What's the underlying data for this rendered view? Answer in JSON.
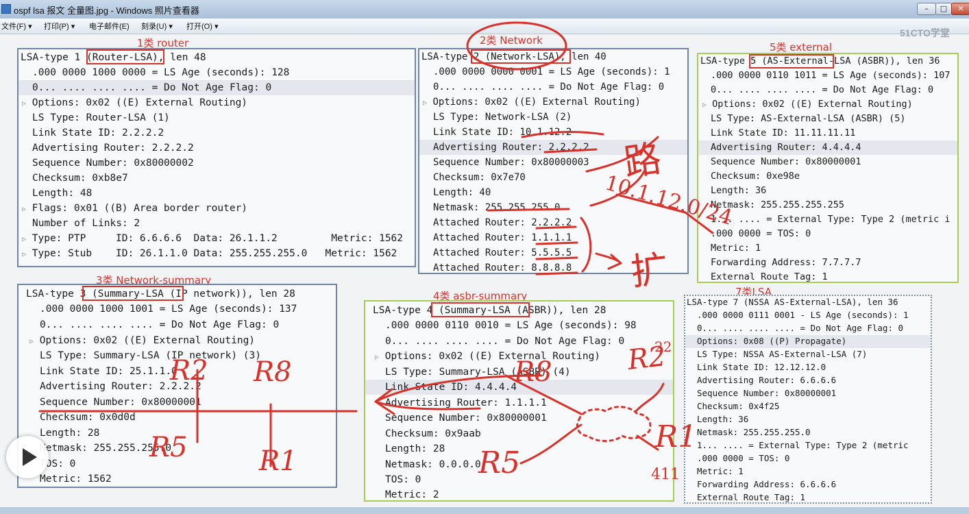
{
  "window": {
    "title": "ospf lsa 报文 全量图.jpg - Windows 照片查看器",
    "brand": "51CTO学堂"
  },
  "menu": [
    "文件(F) ▾",
    "打印(P) ▾",
    "电子邮件(E)",
    "刻录(U) ▾",
    "打开(O) ▾"
  ],
  "captions": {
    "router": "1类 router",
    "network": "2类 Network",
    "external": "5类 external",
    "summary": "3类  Network-summary",
    "asbr": "4类 asbr-summary",
    "nssa": "7类LSA"
  },
  "panels": {
    "router": [
      "LSA-type 1 (Router-LSA), len 48",
      ".000 0000 1000 0000 = LS Age (seconds): 128",
      "0... .... .... .... = Do Not Age Flag: 0",
      "Options: 0x02 ((E) External Routing)",
      "LS Type: Router-LSA (1)",
      "Link State ID: 2.2.2.2",
      "Advertising Router: 2.2.2.2",
      "Sequence Number: 0x80000002",
      "Checksum: 0xb8e7",
      "Length: 48",
      "Flags: 0x01 ((B) Area border router)",
      "Number of Links: 2",
      "Type: PTP     ID: 6.6.6.6  Data: 26.1.1.2         Metric: 1562",
      "Type: Stub    ID: 26.1.1.0 Data: 255.255.255.0   Metric: 1562"
    ],
    "network": [
      "LSA-type 2 (Network-LSA), len 40",
      ".000 0000 0000 0001 = LS Age (seconds): 1",
      "0... .... .... .... = Do Not Age Flag: 0",
      "Options: 0x02 ((E) External Routing)",
      "LS Type: Network-LSA (2)",
      "Link State ID: 10.1.12.2",
      "Advertising Router: 2.2.2.2",
      "Sequence Number: 0x80000003",
      "Checksum: 0x7e70",
      "Length: 40",
      "Netmask: 255.255.255.0",
      "Attached Router: 2.2.2.2",
      "Attached Router: 1.1.1.1",
      "Attached Router: 5.5.5.5",
      "Attached Router: 8.8.8.8"
    ],
    "external": [
      "LSA-type 5 (AS-External-LSA (ASBR)), len 36",
      ".000 0000 0110 1011 = LS Age (seconds): 107",
      "0... .... .... .... = Do Not Age Flag: 0",
      "Options: 0x02 ((E) External Routing)",
      "LS Type: AS-External-LSA (ASBR) (5)",
      "Link State ID: 11.11.11.11",
      "Advertising Router: 4.4.4.4",
      "Sequence Number: 0x80000001",
      "Checksum: 0xe98e",
      "Length: 36",
      "Netmask: 255.255.255.255",
      "1... .... = External Type: Type 2 (metric i",
      ".000 0000 = TOS: 0",
      "Metric: 1",
      "Forwarding Address: 7.7.7.7",
      "External Route Tag: 1"
    ],
    "summary": [
      "LSA-type 3 (Summary-LSA (IP network)), len 28",
      ".000 0000 1000 1001 = LS Age (seconds): 137",
      "0... .... .... .... = Do Not Age Flag: 0",
      "Options: 0x02 ((E) External Routing)",
      "LS Type: Summary-LSA (IP network) (3)",
      "Link State ID: 25.1.1.0",
      "Advertising Router: 2.2.2.2",
      "Sequence Number: 0x80000001",
      "Checksum: 0x0d0d",
      "Length: 28",
      "Netmask: 255.255.255.0",
      "TOS: 0",
      "Metric: 1562"
    ],
    "asbr": [
      "LSA-type 4 (Summary-LSA (ASBR)), len 28",
      ".000 0000 0110 0010 = LS Age (seconds): 98",
      "0... .... .... .... = Do Not Age Flag: 0",
      "Options: 0x02 ((E) External Routing)",
      "LS Type: Summary-LSA (ASBR) (4)",
      "Link State ID: 4.4.4.4",
      "Advertising Router: 1.1.1.1",
      "Sequence Number: 0x80000001",
      "Checksum: 0x9aab",
      "Length: 28",
      "Netmask: 0.0.0.0",
      "TOS: 0",
      "Metric: 2"
    ],
    "nssa": [
      "LSA-type 7 (NSSA AS-External-LSA), len 36",
      ".000 0000 0111 0001 - LS Age (seconds): 1",
      "0... .... .... .... = Do Not Age Flag: 0",
      "Options: 0x08 ((P) Propagate)",
      "LS Type: NSSA AS-External-LSA (7)",
      "Link State ID: 12.12.12.0",
      "Advertising Router: 6.6.6.6",
      "Sequence Number: 0x80000001",
      "Checksum: 0x4f25",
      "Length: 36",
      "Netmask: 255.255.255.0",
      "1... .... = External Type: Type 2 (metric",
      ".000 0000 = TOS: 0",
      "Metric: 1",
      "Forwarding Address: 6.6.6.6",
      "External Route Tag: 1"
    ]
  },
  "annotations": {
    "route": "路",
    "subnet": "10.1.12.0/24",
    "extend": "扩",
    "r2_summary": "R2",
    "r8": "R8",
    "r5_summary": "R5",
    "r1_summary": "R1",
    "r8_asbr": "R8",
    "r5_asbr": "R5",
    "r2_asbr": "R2",
    "r1_asbr": "R1",
    "bg_22": "22",
    "bg_411": "411"
  },
  "play_button_label": "play-video",
  "colors": {
    "ink": "#d8312a",
    "blue_frame": "#6e86a3",
    "green_frame": "#a9cc52"
  }
}
